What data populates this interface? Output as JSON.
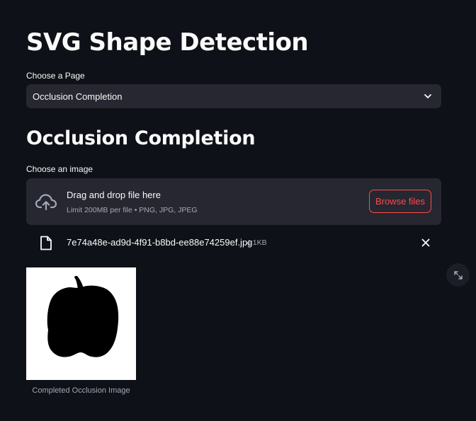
{
  "app": {
    "title": "SVG Shape Detection"
  },
  "page_select": {
    "label": "Choose a Page",
    "selected": "Occlusion Completion"
  },
  "section": {
    "title": "Occlusion Completion"
  },
  "uploader": {
    "label": "Choose an image",
    "drop_text": "Drag and drop file here",
    "limit_text": "Limit 200MB per file • PNG, JPG, JPEG",
    "browse_label": "Browse files"
  },
  "uploaded_file": {
    "name": "7e74a48e-ad9d-4f91-b8bd-ee88e74259ef.jpg",
    "size": "4.1KB"
  },
  "result_image": {
    "caption": "Completed Occlusion Image"
  },
  "colors": {
    "background": "#0e1117",
    "surface": "#262730",
    "accent": "#ff4b4b",
    "text": "#fafafa",
    "muted_text": "#a3a8b8"
  },
  "icons": {
    "select_chevron": "chevron-down-icon",
    "upload": "cloud-upload-icon",
    "file": "file-icon",
    "remove": "close-icon",
    "fullscreen": "fullscreen-icon"
  }
}
